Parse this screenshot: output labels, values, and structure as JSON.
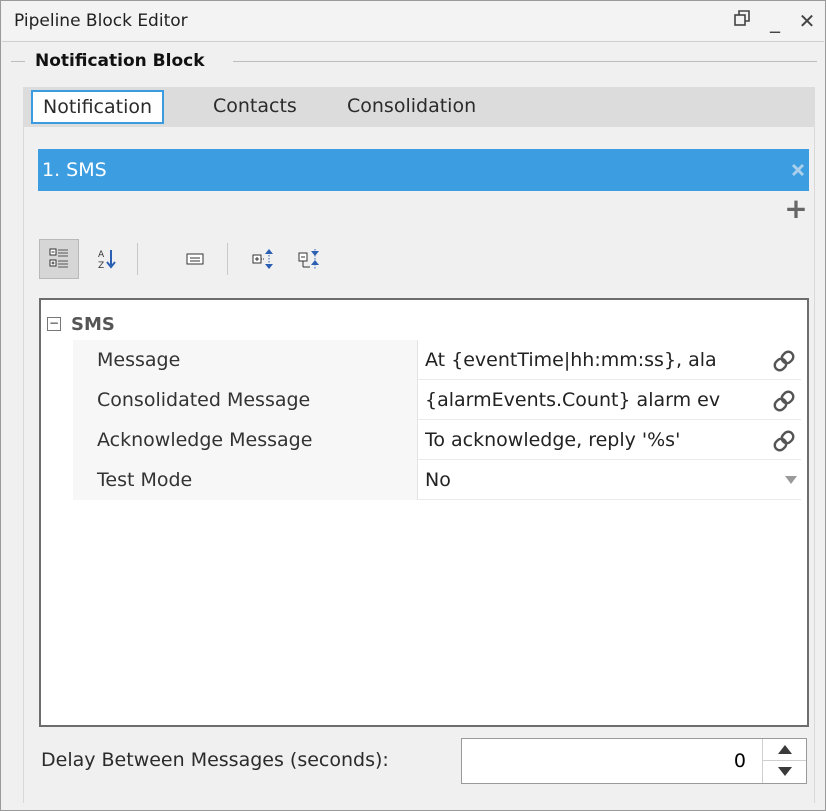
{
  "window": {
    "title": "Pipeline Block Editor",
    "controls": {
      "restore_icon": "restore-icon",
      "minimize_label": "_",
      "close_label": "✕"
    }
  },
  "section": {
    "title": "Notification Block"
  },
  "tabs": [
    {
      "label": "Notification",
      "active": true
    },
    {
      "label": "Contacts",
      "active": false
    },
    {
      "label": "Consolidation",
      "active": false
    }
  ],
  "profiles": {
    "items": [
      {
        "label": "1.  SMS",
        "selected": true
      }
    ],
    "remove_icon": "close-icon",
    "add_label": "+"
  },
  "toolbar": {
    "buttons": [
      {
        "icon": "categorized-view-icon",
        "active": true
      },
      {
        "icon": "alphabetical-sort-icon",
        "active": false
      },
      {
        "icon": "description-toggle-icon",
        "active": false
      },
      {
        "icon": "expand-all-icon",
        "active": false
      },
      {
        "icon": "collapse-all-icon",
        "active": false
      }
    ]
  },
  "properties": {
    "category": "SMS",
    "collapse_label": "−",
    "rows": [
      {
        "name": "Message",
        "value": "At {eventTime|hh:mm:ss}, ala",
        "has_binding": true
      },
      {
        "name": "Consolidated Message",
        "value": "{alarmEvents.Count} alarm ev",
        "has_binding": true
      },
      {
        "name": "Acknowledge Message",
        "value": "To acknowledge, reply '%s'",
        "has_binding": true
      },
      {
        "name": "Test Mode",
        "value": "No",
        "has_dropdown": true
      }
    ]
  },
  "delay": {
    "label": "Delay Between Messages (seconds):",
    "value": "0"
  },
  "colors": {
    "accent": "#3c9ee0",
    "tab_border": "#3b9be0",
    "panel_bg": "#f0f0f0"
  }
}
